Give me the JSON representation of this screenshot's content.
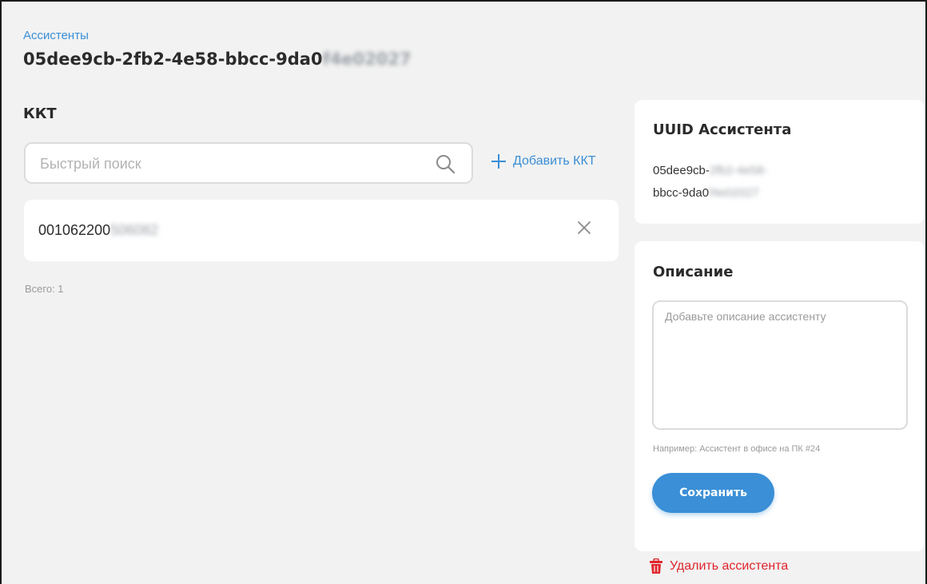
{
  "breadcrumb": {
    "parent_label": "Ассистенты"
  },
  "page": {
    "title_visible": "05dee9cb-2fb2-4e58-bbcc-9da0",
    "title_blurred": "f4e02027"
  },
  "kkt_section": {
    "title": "ККТ",
    "search_placeholder": "Быстрый поиск",
    "add_label": "Добавить ККТ",
    "items": [
      {
        "serial_visible": "001062200",
        "serial_blurred": "506082"
      }
    ],
    "total_label": "Всего: 1"
  },
  "uuid_card": {
    "title": "UUID Ассистента",
    "line1_visible": "05dee9cb-",
    "line1_blurred": "2fb2-4e58-",
    "line2_visible": "bbcc-9da0",
    "line2_blurred": "f4e02027"
  },
  "description_card": {
    "title": "Описание",
    "placeholder": "Добавьте описание ассистенту",
    "value": "",
    "hint": "Например: Ассистент в офисе на ПК #24",
    "save_label": "Сохранить"
  },
  "delete_label": "Удалить ассистента",
  "colors": {
    "accent": "#3a8fd6",
    "danger": "#e0242c",
    "background": "#f2f2f2",
    "card": "#ffffff"
  },
  "icons": {
    "search": "search-icon",
    "add": "plus-icon",
    "remove": "close-icon",
    "delete": "trash-icon"
  }
}
